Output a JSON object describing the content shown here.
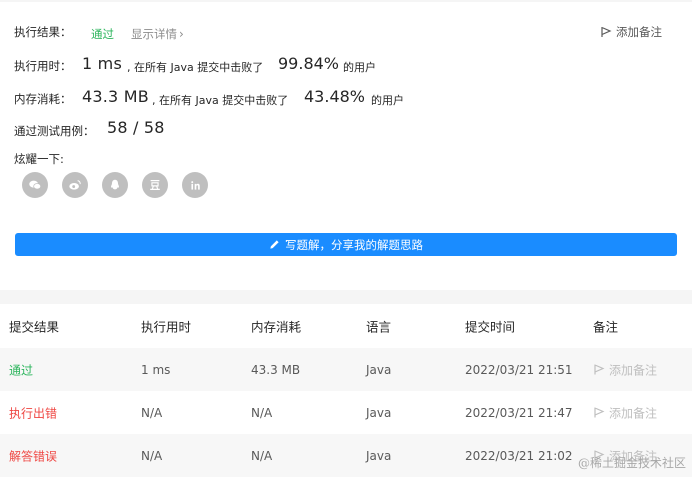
{
  "summary": {
    "result_label": "执行结果：",
    "result_status": "通过",
    "detail_link": "显示详情",
    "add_note": "添加备注",
    "runtime_label": "执行用时：",
    "runtime_value": "1 ms",
    "runtime_text": ", 在所有 Java 提交中击败了",
    "runtime_pct": "99.84%",
    "users": "的用户",
    "memory_label": "内存消耗：",
    "memory_value": "43.3 MB",
    "memory_text": ", 在所有 Java 提交中击败了",
    "memory_pct": "43.48%",
    "tests_label": "通过测试用例：",
    "tests_value": "58 / 58",
    "share_label": "炫耀一下:",
    "share_icons": [
      "wechat-icon",
      "weibo-icon",
      "qq-icon",
      "douban-icon",
      "linkedin-icon"
    ],
    "write_solution": "写题解，分享我的解题思路"
  },
  "table": {
    "headers": [
      "提交结果",
      "执行用时",
      "内存消耗",
      "语言",
      "提交时间",
      "备注"
    ],
    "rows": [
      {
        "result": "通过",
        "status": "ok",
        "runtime": "1 ms",
        "memory": "43.3 MB",
        "lang": "Java",
        "time": "2022/03/21 21:51",
        "note": "添加备注"
      },
      {
        "result": "执行出错",
        "status": "err",
        "runtime": "N/A",
        "memory": "N/A",
        "lang": "Java",
        "time": "2022/03/21 21:47",
        "note": "添加备注"
      },
      {
        "result": "解答错误",
        "status": "err",
        "runtime": "N/A",
        "memory": "N/A",
        "lang": "Java",
        "time": "2022/03/21 21:02",
        "note": "添加备注"
      }
    ]
  },
  "watermark": "@稀土掘金技术社区",
  "colors": {
    "accent": "#1a8cff",
    "success": "#2db55d",
    "error": "#ef4743"
  }
}
